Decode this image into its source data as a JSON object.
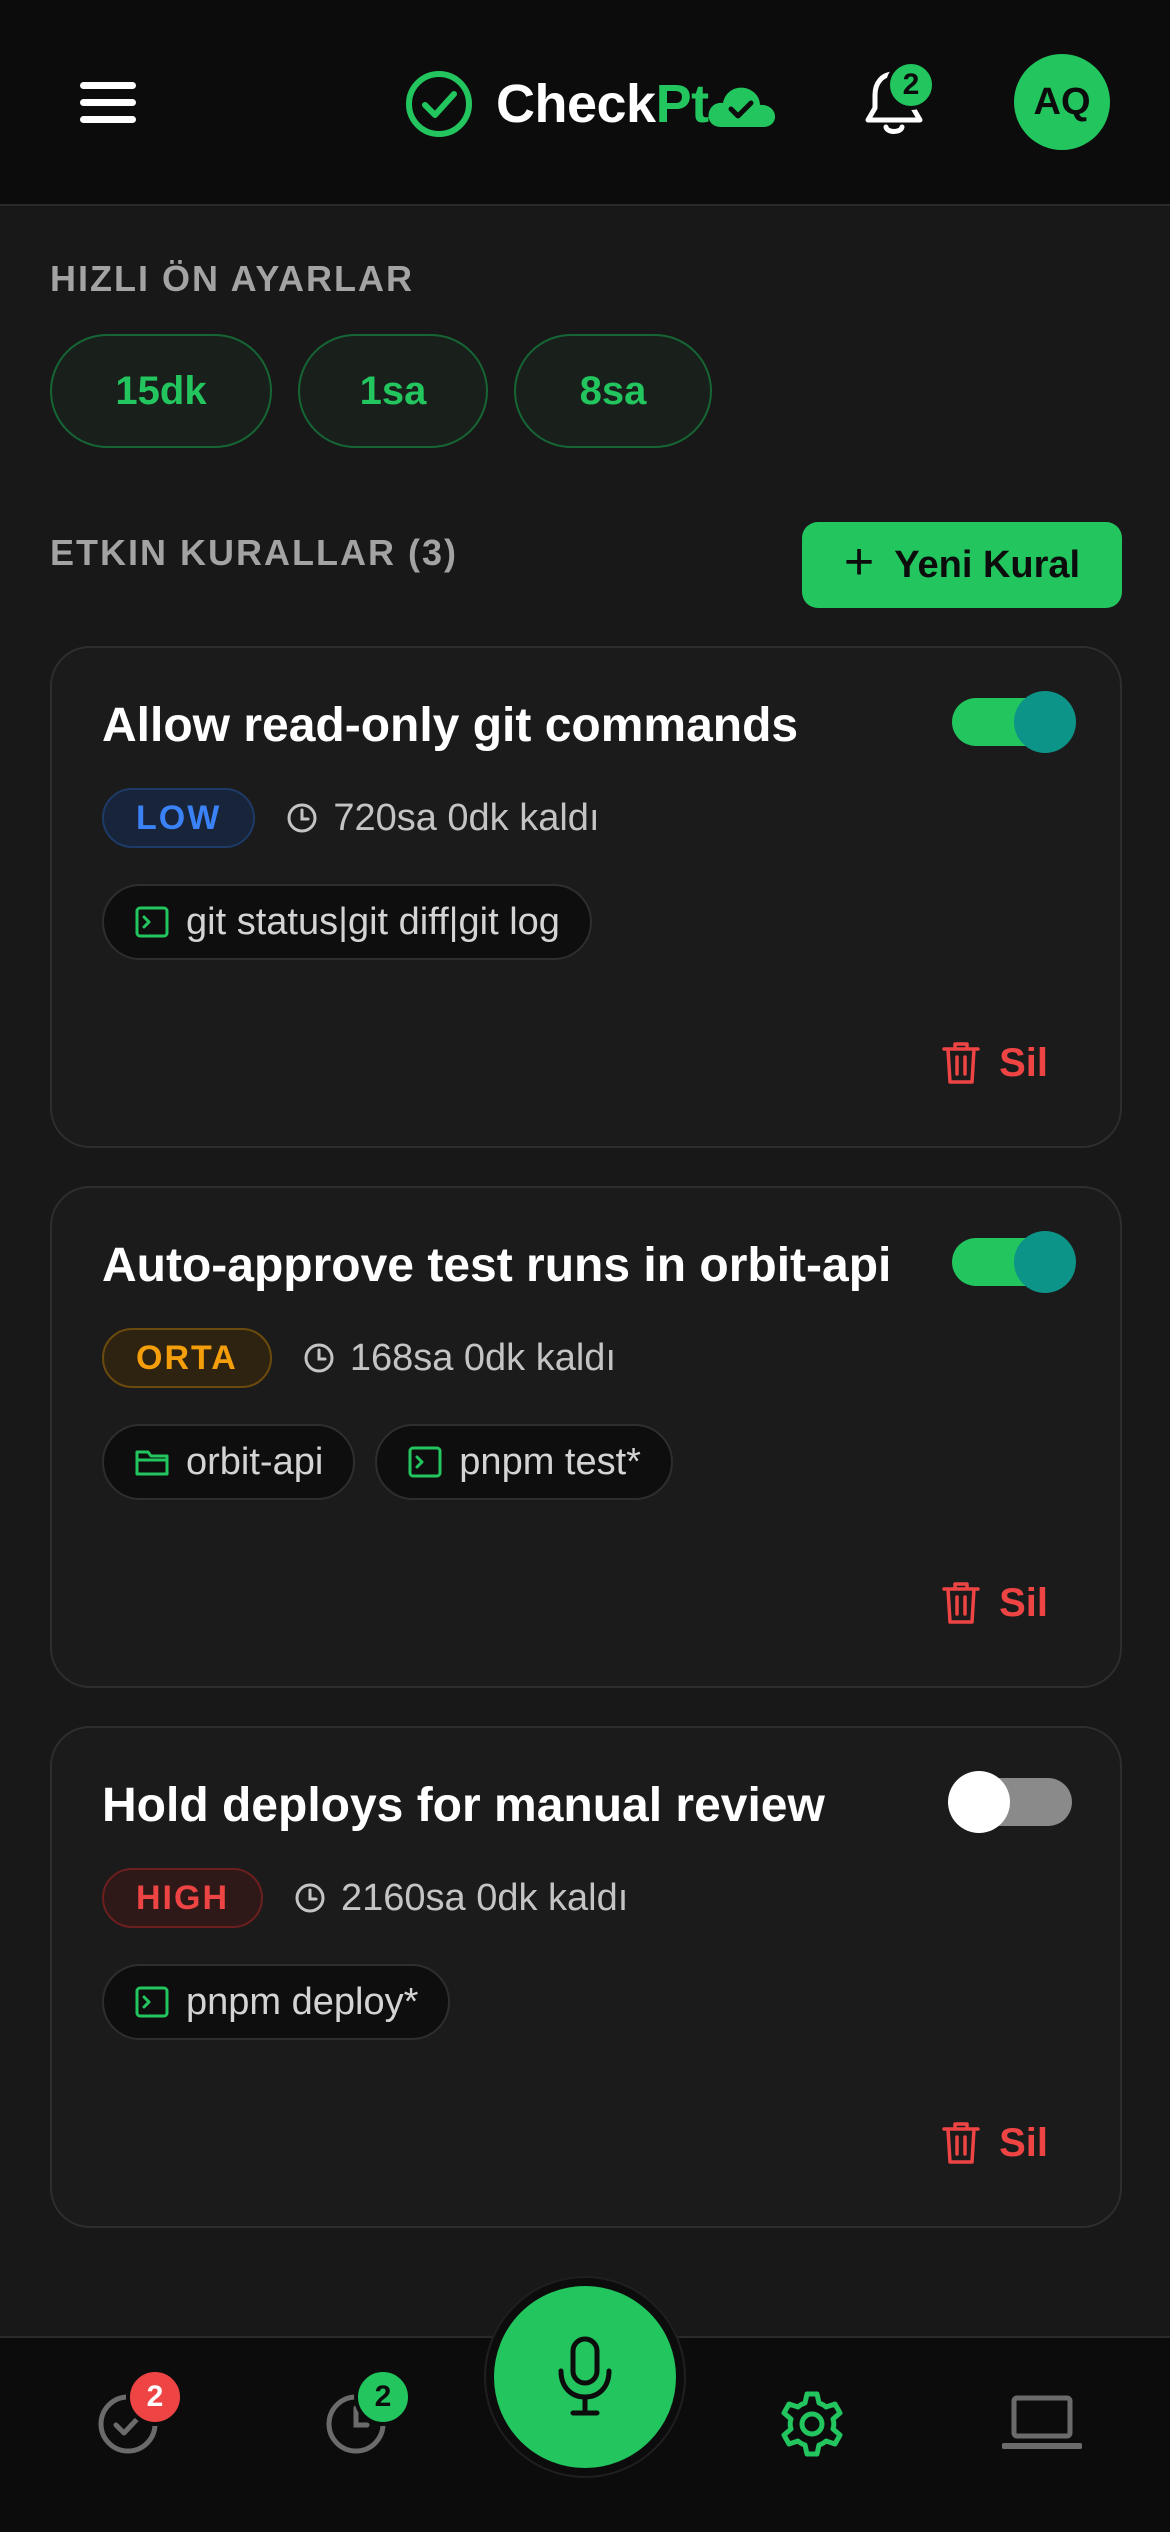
{
  "header": {
    "logo_part1": "Check",
    "logo_part2": "Pt",
    "notifications_count": "2",
    "avatar_initials": "AQ"
  },
  "presets": {
    "title": "HIZLI ÖN AYARLAR",
    "items": [
      "15dk",
      "1sa",
      "8sa"
    ]
  },
  "rules": {
    "title": "ETKIN KURALLAR (3)",
    "new_rule_label": "Yeni Kural",
    "items": [
      {
        "title": "Allow read-only git commands",
        "enabled": true,
        "level": "LOW",
        "remaining": "720sa 0dk kaldı",
        "chips": [
          {
            "icon": "terminal-icon",
            "text": "git status|git diff|git log"
          }
        ],
        "delete_label": "Sil"
      },
      {
        "title": "Auto-approve test runs in orbit-api",
        "enabled": true,
        "level": "ORTA",
        "remaining": "168sa 0dk kaldı",
        "chips": [
          {
            "icon": "folder-icon",
            "text": "orbit-api"
          },
          {
            "icon": "terminal-icon",
            "text": "pnpm test*"
          }
        ],
        "delete_label": "Sil"
      },
      {
        "title": "Hold deploys for manual review",
        "enabled": false,
        "level": "HIGH",
        "remaining": "2160sa 0dk kaldı",
        "chips": [
          {
            "icon": "terminal-icon",
            "text": "pnpm deploy*"
          }
        ],
        "delete_label": "Sil"
      }
    ]
  },
  "bottom_nav": {
    "approvals_badge": "2",
    "history_badge": "2"
  },
  "colors": {
    "accent": "#22c55e",
    "danger": "#ef4444",
    "warning": "#f59e0b",
    "info": "#3b82f6",
    "background": "#181818"
  }
}
